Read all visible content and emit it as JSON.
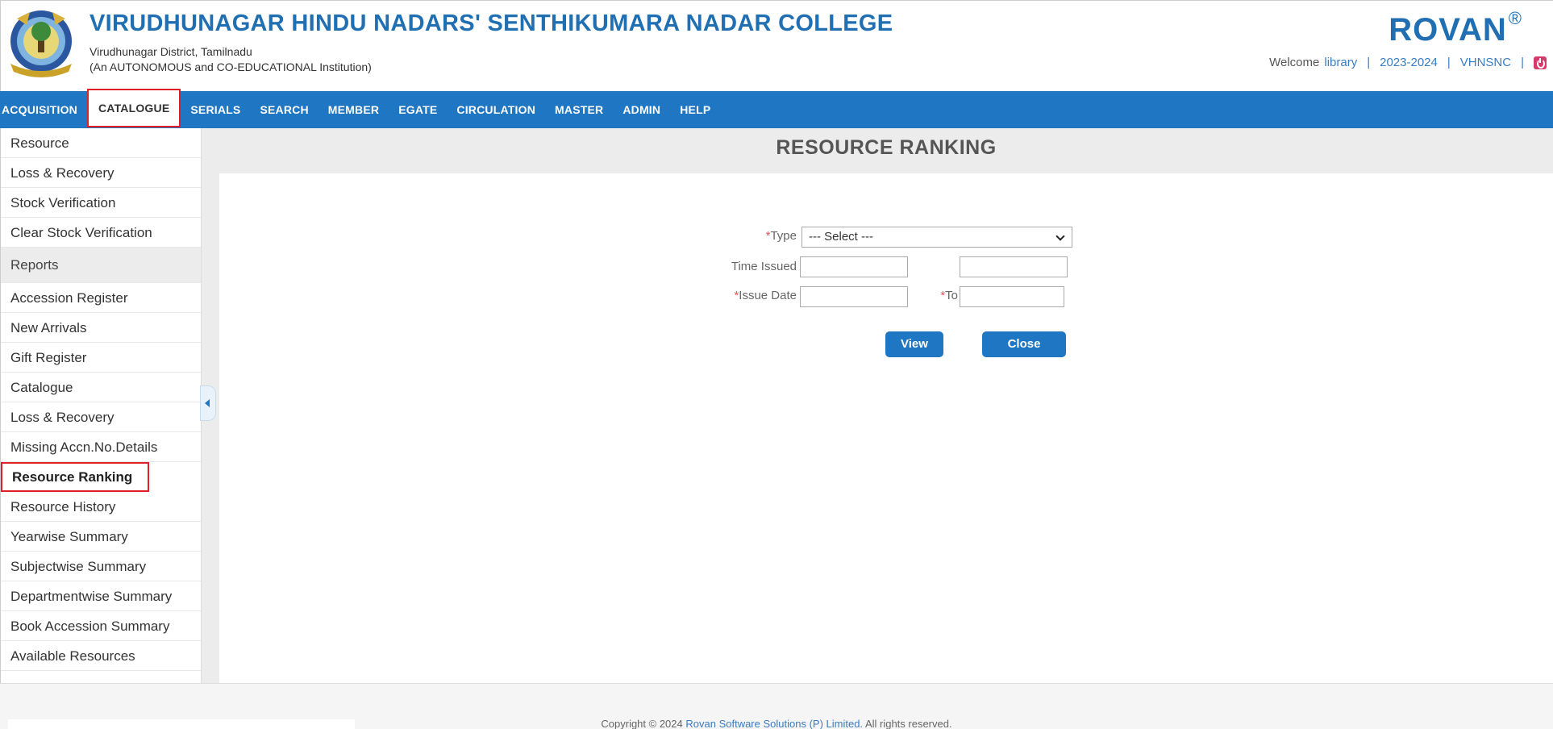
{
  "header": {
    "college_name": "VIRUDHUNAGAR HINDU NADARS' SENTHIKUMARA NADAR COLLEGE",
    "location": "Virudhunagar District, Tamilnadu",
    "institution_type": "(An AUTONOMOUS and CO-EDUCATIONAL Institution)",
    "brand": "ROVAN",
    "brand_mark": "®",
    "welcome_text": "Welcome",
    "username": "library",
    "academic_year": "2023-2024",
    "institution_code": "VHNSNC",
    "separator": "|"
  },
  "nav": {
    "items": [
      {
        "label": "ACQUISITION"
      },
      {
        "label": "CATALOGUE"
      },
      {
        "label": "SERIALS"
      },
      {
        "label": "SEARCH"
      },
      {
        "label": "MEMBER"
      },
      {
        "label": "EGATE"
      },
      {
        "label": "CIRCULATION"
      },
      {
        "label": "MASTER"
      },
      {
        "label": "ADMIN"
      },
      {
        "label": "HELP"
      }
    ],
    "active": "CATALOGUE"
  },
  "sidebar": {
    "items": [
      {
        "label": "Resource"
      },
      {
        "label": "Loss & Recovery"
      },
      {
        "label": "Stock Verification"
      },
      {
        "label": "Clear Stock Verification"
      },
      {
        "label": "Reports"
      },
      {
        "label": "Accession Register"
      },
      {
        "label": "New Arrivals"
      },
      {
        "label": "Gift Register"
      },
      {
        "label": "Catalogue"
      },
      {
        "label": "Loss & Recovery"
      },
      {
        "label": "Missing Accn.No.Details"
      },
      {
        "label": "Resource Ranking"
      },
      {
        "label": "Resource History"
      },
      {
        "label": "Yearwise Summary"
      },
      {
        "label": "Subjectwise Summary"
      },
      {
        "label": "Departmentwise Summary"
      },
      {
        "label": "Book Accession Summary"
      },
      {
        "label": "Available Resources"
      }
    ],
    "selected": "Resource Ranking"
  },
  "main": {
    "title": "RESOURCE RANKING",
    "form": {
      "required_marker": "*",
      "type_label": "Type",
      "type_value": "--- Select ---",
      "time_issued_label": "Time Issued",
      "time_issued_from": "",
      "time_issued_to": "",
      "issue_date_label": "Issue Date",
      "to_label": "To",
      "issue_date_from": "",
      "issue_date_to": ""
    },
    "buttons": {
      "view": "View",
      "close": "Close"
    }
  },
  "footer": {
    "copyright_prefix": "Copyright © 2024",
    "company": "Rovan Software Solutions (P) Limited.",
    "suffix": "All rights reserved."
  },
  "colors": {
    "primary": "#1f76c2",
    "highlight": "#e01f26",
    "title": "#1f6fb2"
  }
}
